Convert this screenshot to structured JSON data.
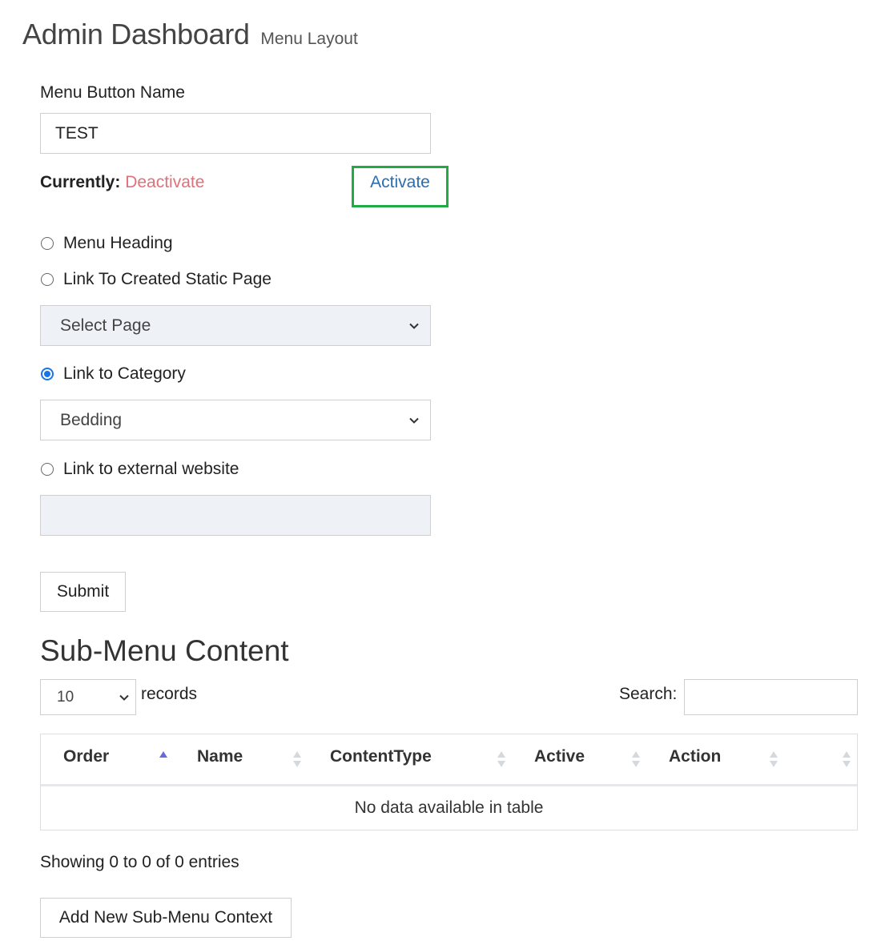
{
  "header": {
    "title": "Admin Dashboard",
    "subtitle": "Menu Layout"
  },
  "form": {
    "name_label": "Menu Button Name",
    "name_value": "TEST",
    "currently_label": "Currently:",
    "current_status": "Deactivate",
    "activate_link": "Activate",
    "options": [
      {
        "label": "Menu Heading",
        "checked": false
      },
      {
        "label": "Link To Created Static Page",
        "checked": false
      },
      {
        "label": "Link to Category",
        "checked": true
      },
      {
        "label": "Link to external website",
        "checked": false
      }
    ],
    "page_select": "Select Page",
    "category_select": "Bedding",
    "external_url": "",
    "submit_label": "Submit"
  },
  "submenu": {
    "title": "Sub-Menu Content",
    "records_per_page": "10",
    "records_label": "records",
    "search_label": "Search:",
    "search_value": "",
    "columns": [
      "Order",
      "Name",
      "ContentType",
      "Active",
      "Action"
    ],
    "empty_message": "No data available in table",
    "info": "Showing 0 to 0 of 0 entries",
    "add_button": "Add New Sub-Menu Context"
  },
  "colors": {
    "deactivate": "#e0707a",
    "activate_link": "#2a6db0",
    "highlight_border": "#22aa44",
    "radio_checked": "#1a73e8"
  }
}
